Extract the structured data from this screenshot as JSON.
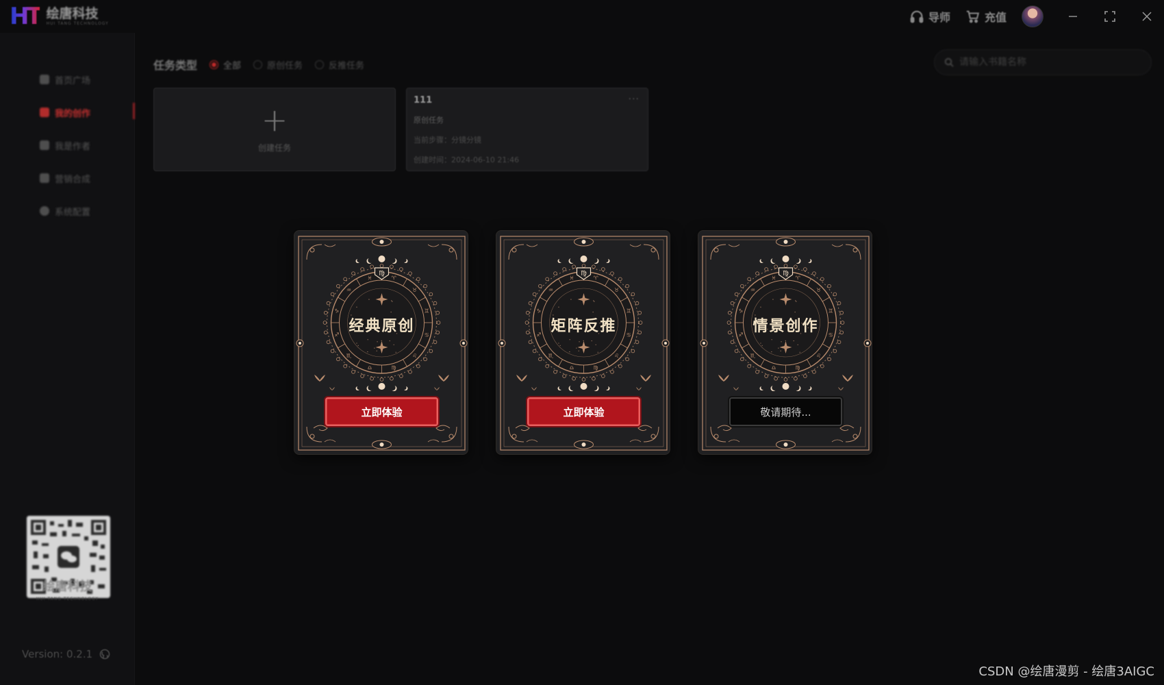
{
  "app": {
    "logo_mark": "HT",
    "logo_name": "绘唐科技",
    "logo_sub": "HUI TANG TECHNOLOGY"
  },
  "titlebar": {
    "support_label": "导师",
    "recharge_label": "充值",
    "minimize": "–",
    "maximize": "⛶",
    "close": "✕"
  },
  "sidebar": {
    "items": [
      {
        "label": "首页广场",
        "icon": "home-icon",
        "active": false
      },
      {
        "label": "我的创作",
        "icon": "creation-icon",
        "active": true
      },
      {
        "label": "我是作者",
        "icon": "author-icon",
        "active": false
      },
      {
        "label": "营销合成",
        "icon": "marketing-icon",
        "active": false
      },
      {
        "label": "系统配置",
        "icon": "settings-icon",
        "active": false
      }
    ],
    "qr_brand_cn": "绘唐科技",
    "qr_brand_en": "HUI TANG TECHNOLOGY",
    "version": "Version: 0.2.1"
  },
  "filters": {
    "title": "任务类型",
    "options": [
      {
        "label": "全部",
        "checked": true
      },
      {
        "label": "原创任务",
        "checked": false
      },
      {
        "label": "反推任务",
        "checked": false
      }
    ]
  },
  "search": {
    "placeholder": "请输入书籍名称",
    "value": ""
  },
  "create_task": {
    "plus": "+",
    "label": "创建任务"
  },
  "task": {
    "title": "111",
    "more": "···",
    "type": "原创任务",
    "step": "当前步骤：分镜分镜",
    "created": "创建时间：2024-06-10 21:46"
  },
  "features": [
    {
      "title": "经典原创",
      "button": "立即体验",
      "enabled": true
    },
    {
      "title": "矩阵反推",
      "button": "立即体验",
      "enabled": true
    },
    {
      "title": "情景创作",
      "button": "敬请期待...",
      "enabled": false
    }
  ],
  "watermark": "CSDN @绘唐漫剪 - 绘唐3AIGC",
  "colors": {
    "accent_red": "#b1151d",
    "background": "#0c0c0d",
    "card_gold": "#c99a78"
  }
}
